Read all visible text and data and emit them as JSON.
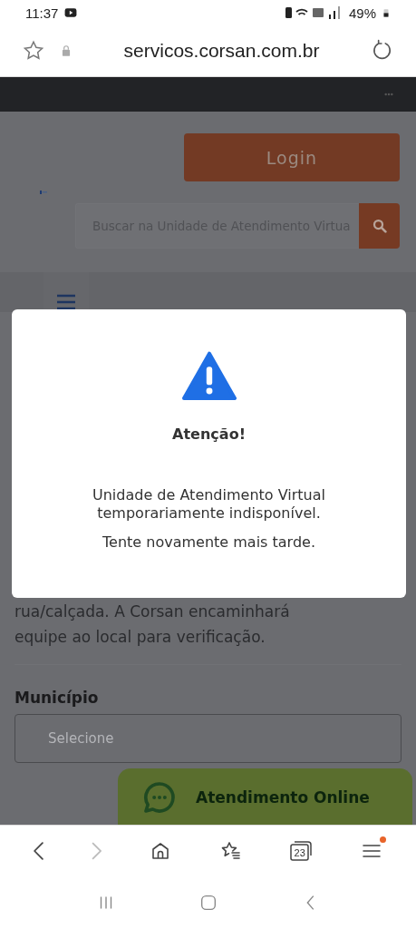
{
  "status_bar": {
    "time": "11:37",
    "battery": "49%"
  },
  "address_bar": {
    "url": "servicos.corsan.com.br"
  },
  "page": {
    "login_button": "Login",
    "search": {
      "placeholder": "Buscar na Unidade de Atendimento Virtua"
    },
    "body_lines": [
      "rua/calçada. A Corsan encaminhará",
      "equipe ao local para verificação."
    ],
    "field_label": "Município",
    "select": {
      "placeholder": "Selecione"
    },
    "chat_button": "Atendimento Online"
  },
  "dialog": {
    "title": "Atenção!",
    "message": "Unidade de Atendimento Virtual temporariamente indisponível.",
    "hint": "Tente novamente mais tarde."
  },
  "toolbar": {
    "tab_count": "23",
    "forward_disabled": true,
    "menu_notification": true
  }
}
